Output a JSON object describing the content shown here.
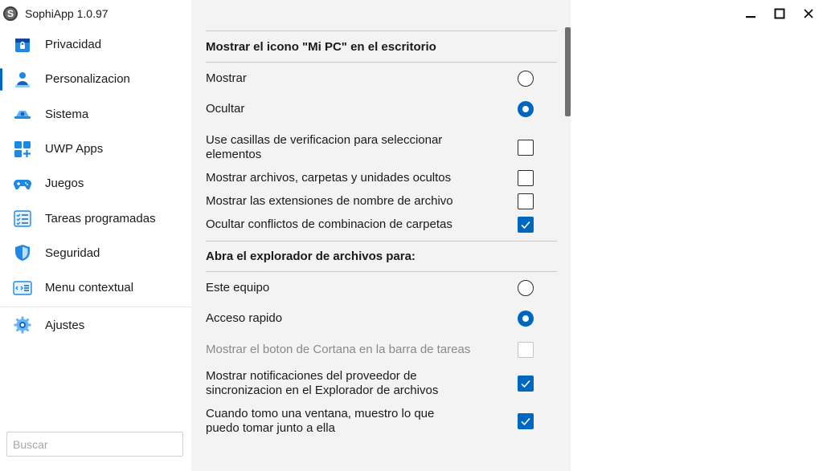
{
  "app": {
    "title": "SophiApp 1.0.97",
    "logo_letter": "S"
  },
  "sidebar": {
    "items": [
      {
        "label": "Privacidad"
      },
      {
        "label": "Personalizacion"
      },
      {
        "label": "Sistema"
      },
      {
        "label": "UWP Apps"
      },
      {
        "label": "Juegos"
      },
      {
        "label": "Tareas programadas"
      },
      {
        "label": "Seguridad"
      },
      {
        "label": "Menu contextual"
      },
      {
        "label": "Ajustes"
      }
    ],
    "active_item": "Personalizacion",
    "search": {
      "placeholder": "Buscar",
      "value": ""
    }
  },
  "content": {
    "section1": {
      "title": "Mostrar el icono \"Mi PC\" en el escritorio",
      "options": [
        {
          "label": "Mostrar",
          "selected": false
        },
        {
          "label": "Ocultar",
          "selected": true
        }
      ]
    },
    "checks1": [
      {
        "label": "Use casillas de verificacion para seleccionar elementos",
        "checked": false
      },
      {
        "label": "Mostrar archivos, carpetas y unidades ocultos",
        "checked": false
      },
      {
        "label": "Mostrar las extensiones de nombre de archivo",
        "checked": false
      },
      {
        "label": "Ocultar conflictos de combinacion de carpetas",
        "checked": true
      }
    ],
    "section2": {
      "title": "Abra el explorador de archivos para:",
      "options": [
        {
          "label": "Este equipo",
          "selected": false
        },
        {
          "label": "Acceso rapido",
          "selected": true
        }
      ]
    },
    "checks2": [
      {
        "label": "Mostrar el boton de Cortana en la barra de tareas",
        "checked": false,
        "disabled": true
      },
      {
        "label": "Mostrar notificaciones del proveedor de sincronizacion en el Explorador de archivos",
        "checked": true
      },
      {
        "label": "Cuando tomo una ventana, muestro lo que puedo tomar junto a ella",
        "checked": true
      }
    ]
  },
  "colors": {
    "accent": "#0067c0",
    "content_bg": "#f3f3f3",
    "scrollbar": "#6f6f6f"
  },
  "icons": {
    "window_controls": [
      "minimize-icon",
      "maximize-icon",
      "close-icon"
    ]
  }
}
